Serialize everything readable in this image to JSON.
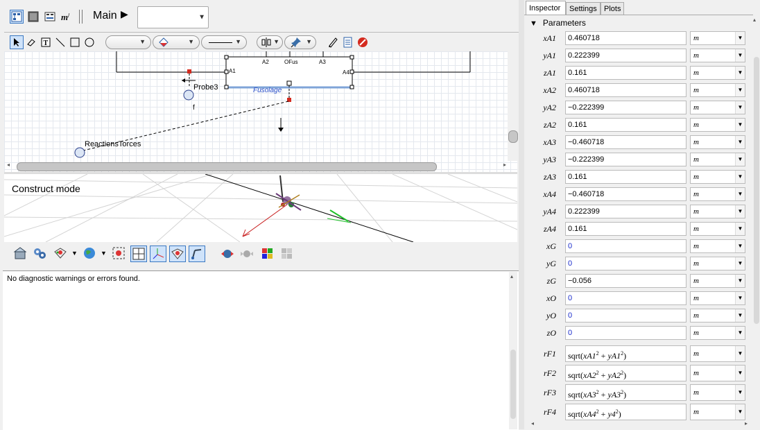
{
  "toolbar": {
    "main_label": "Main",
    "play_glyph": "▶",
    "combo_value": "",
    "icons": [
      "diagram-view-icon",
      "icon-view-icon",
      "parameters-view-icon",
      "modelica-text-icon"
    ]
  },
  "drawing_tools": [
    "select-arrow-icon",
    "eraser-icon",
    "text-tool-icon",
    "line-tool-icon",
    "rectangle-tool-icon",
    "ellipse-tool-icon"
  ],
  "diagram": {
    "block_name": "Fusolage",
    "block_ports": {
      "a1": "A1",
      "a2": "A2",
      "ofus": "OFus",
      "a3": "A3",
      "a4": "A4"
    },
    "probe_label": "Probe3",
    "probe_var": "f",
    "reactions_label": "ReactionsTorces"
  },
  "view3d": {
    "mode_label": "Construct mode"
  },
  "messages": {
    "text": "No diagnostic warnings or errors found."
  },
  "inspector": {
    "tabs": [
      "Inspector",
      "Settings",
      "Plots"
    ],
    "active_tab": "Inspector",
    "section": "Parameters",
    "rows": [
      {
        "name": "xA1",
        "value": "0.460718",
        "unit": "m"
      },
      {
        "name": "yA1",
        "value": "0.222399",
        "unit": "m"
      },
      {
        "name": "zA1",
        "value": "0.161",
        "unit": "m"
      },
      {
        "name": "xA2",
        "value": "0.460718",
        "unit": "m"
      },
      {
        "name": "yA2",
        "value": "−0.222399",
        "unit": "m"
      },
      {
        "name": "zA2",
        "value": "0.161",
        "unit": "m"
      },
      {
        "name": "xA3",
        "value": "−0.460718",
        "unit": "m"
      },
      {
        "name": "yA3",
        "value": "−0.222399",
        "unit": "m"
      },
      {
        "name": "zA3",
        "value": "0.161",
        "unit": "m"
      },
      {
        "name": "xA4",
        "value": "−0.460718",
        "unit": "m"
      },
      {
        "name": "yA4",
        "value": "0.222399",
        "unit": "m"
      },
      {
        "name": "zA4",
        "value": "0.161",
        "unit": "m"
      },
      {
        "name": "xG",
        "value": "0",
        "unit": "m"
      },
      {
        "name": "yG",
        "value": "0",
        "unit": "m"
      },
      {
        "name": "zG",
        "value": "−0.056",
        "unit": "m"
      },
      {
        "name": "xO",
        "value": "0",
        "unit": "m"
      },
      {
        "name": "yO",
        "value": "0",
        "unit": "m"
      },
      {
        "name": "zO",
        "value": "0",
        "unit": "m"
      }
    ],
    "formula_rows": [
      {
        "name": "rF1",
        "func": "sqrt",
        "a": "xA1",
        "b": "yA1",
        "unit": "m"
      },
      {
        "name": "rF2",
        "func": "sqrt",
        "a": "xA2",
        "b": "yA2",
        "unit": "m"
      },
      {
        "name": "rF3",
        "func": "sqrt",
        "a": "xA3",
        "b": "yA3",
        "unit": "m"
      },
      {
        "name": "rF4",
        "func": "sqrt",
        "a": "xA4",
        "b": "y4",
        "unit": "m"
      }
    ],
    "blue_value_color": "#1a2ccc"
  }
}
